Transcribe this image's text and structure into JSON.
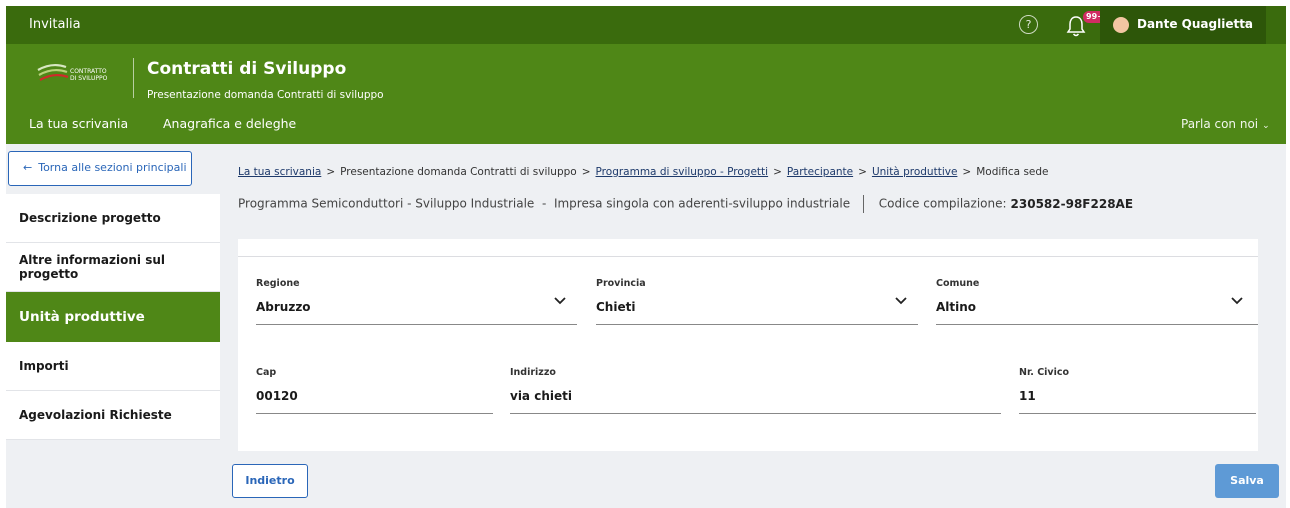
{
  "topbar": {
    "brand": "Invitalia",
    "help_icon": "?",
    "notifications_badge": "99+",
    "user_name": "Dante Quaglietta"
  },
  "header": {
    "logo_text_1": "CONTRATTO",
    "logo_text_2": "DI SVILUPPO",
    "title": "Contratti di Sviluppo",
    "subtitle": "Presentazione domanda Contratti di sviluppo",
    "nav": [
      "La tua scrivania",
      "Anagrafica e deleghe"
    ],
    "parla": "Parla con noi"
  },
  "sidebar": {
    "back_label": "Torna alle sezioni principali",
    "items": [
      {
        "label": "Descrizione progetto"
      },
      {
        "label": "Altre informazioni sul progetto"
      },
      {
        "label": "Unità produttive",
        "active": true
      },
      {
        "label": "Importi"
      },
      {
        "label": "Agevolazioni Richieste"
      }
    ]
  },
  "breadcrumb": [
    {
      "label": "La tua scrivania",
      "link": true
    },
    {
      "label": "Presentazione domanda Contratti di sviluppo",
      "link": false
    },
    {
      "label": "Programma di sviluppo - Progetti",
      "link": true
    },
    {
      "label": "Partecipante",
      "link": true
    },
    {
      "label": "Unità produttive",
      "link": true
    },
    {
      "label": "Modifica sede",
      "link": false
    }
  ],
  "info": {
    "program": "Programma Semiconduttori - Sviluppo Industriale",
    "type": "Impresa singola con aderenti-sviluppo industriale",
    "code_label": "Codice compilazione:",
    "code_value": "230582-98F228AE"
  },
  "form": {
    "regione": {
      "label": "Regione",
      "value": "Abruzzo"
    },
    "provincia": {
      "label": "Provincia",
      "value": "Chieti"
    },
    "comune": {
      "label": "Comune",
      "value": "Altino"
    },
    "cap": {
      "label": "Cap",
      "value": "00120"
    },
    "indirizzo": {
      "label": "Indirizzo",
      "value": "via chieti"
    },
    "civico": {
      "label": "Nr. Civico",
      "value": "11"
    }
  },
  "buttons": {
    "back": "Indietro",
    "save": "Salva"
  },
  "colors": {
    "topbar": "#3a6b0d",
    "header": "#4f8717",
    "link_blue": "#2a66b8",
    "save_blue": "#5e9ad6",
    "badge": "#d12c63"
  }
}
